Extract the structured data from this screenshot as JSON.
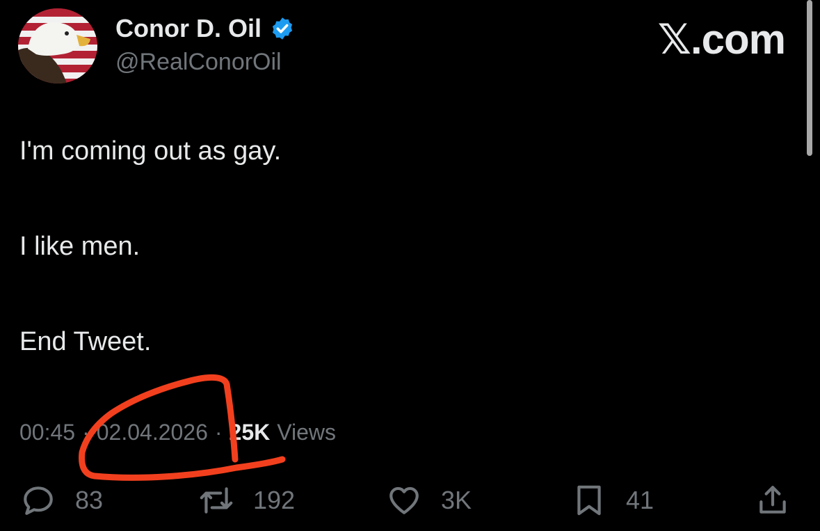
{
  "author": {
    "display_name": "Conor D. Oil",
    "handle": "@RealConorOil",
    "verified": true,
    "avatar_icon": "eagle-flag-avatar"
  },
  "brand": {
    "label": "𝕏.com"
  },
  "tweet": {
    "lines": [
      "I'm coming out as gay.",
      "I like men.",
      "End Tweet."
    ]
  },
  "meta": {
    "time": "00:45",
    "separator": "·",
    "date": "02.04.2026",
    "views_count": "25K",
    "views_label": "Views"
  },
  "actions": {
    "reply": {
      "icon": "reply-icon",
      "count": "83"
    },
    "repost": {
      "icon": "repost-icon",
      "count": "192"
    },
    "like": {
      "icon": "heart-icon",
      "count": "3K"
    },
    "bookmark": {
      "icon": "bookmark-icon",
      "count": "41"
    },
    "share": {
      "icon": "share-icon"
    }
  },
  "colors": {
    "background": "#000000",
    "text_primary": "#e7e9ea",
    "text_secondary": "#71767b",
    "verified_blue": "#1d9bf0",
    "annotation_red": "#f2401e"
  }
}
